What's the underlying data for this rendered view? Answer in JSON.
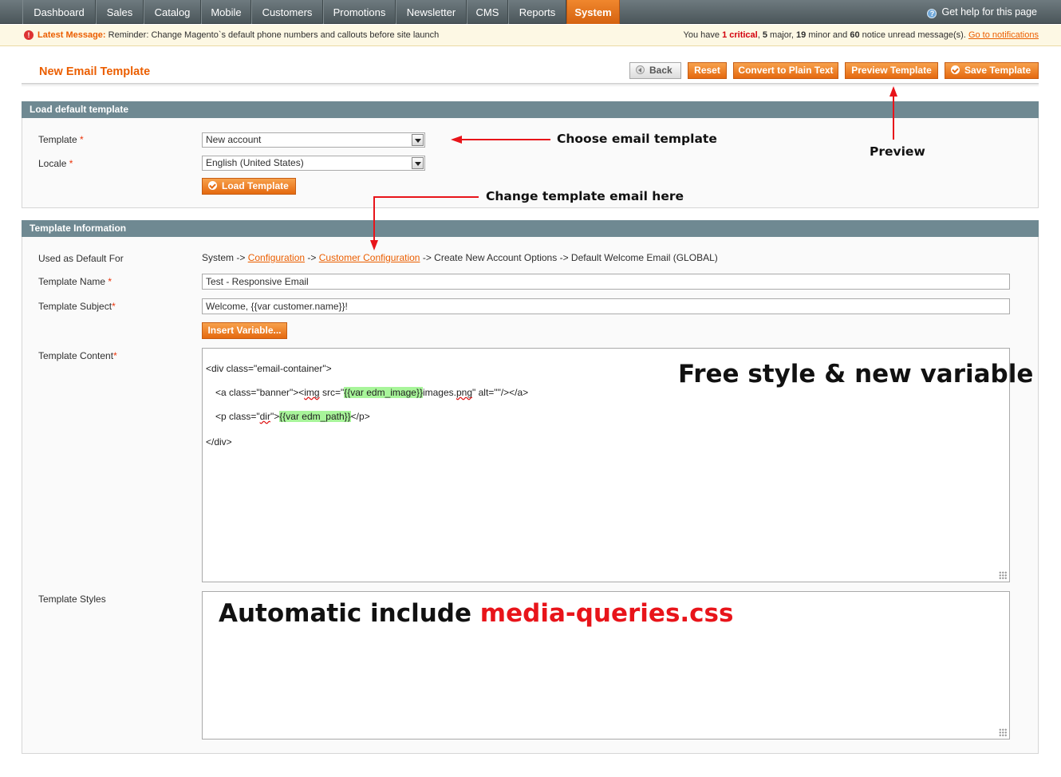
{
  "nav": {
    "items": [
      "Dashboard",
      "Sales",
      "Catalog",
      "Mobile",
      "Customers",
      "Promotions",
      "Newsletter",
      "CMS",
      "Reports",
      "System"
    ],
    "active": "System",
    "help": "Get help for this page"
  },
  "message": {
    "latest_label": "Latest Message:",
    "latest_text": " Reminder: Change Magento`s default phone numbers and callouts before site launch",
    "c1": "You have ",
    "critical_n": "1 critical",
    "c2": ", ",
    "major_n": "5",
    "c3": " major, ",
    "minor_n": "19",
    "c4": " minor and ",
    "notice_n": "60",
    "c5": " notice unread message(s). ",
    "link": "Go to notifications"
  },
  "page": {
    "title": "New Email Template",
    "buttons": {
      "back": "Back",
      "reset": "Reset",
      "plain": "Convert to Plain Text",
      "preview": "Preview Template",
      "save": "Save Template"
    }
  },
  "load": {
    "header": "Load default template",
    "template_label": "Template",
    "template_value": "New account",
    "locale_label": "Locale",
    "locale_value": "English (United States)",
    "load_button": "Load Template",
    "req": "*"
  },
  "info": {
    "header": "Template Information",
    "used_label": "Used as Default For",
    "crumb_1": "System -> ",
    "crumb_link1": "Configuration",
    "crumb_2": " -> ",
    "crumb_link2": "Customer Configuration",
    "crumb_3": " -> Create New Account Options -> Default Welcome Email  (GLOBAL)",
    "name_label": "Template Name",
    "name_value": "Test - Responsive Email",
    "subject_label": "Template Subject",
    "subject_value": "Welcome, {{var customer.name}}!",
    "insert_button": "Insert Variable...",
    "content_label": "Template Content",
    "styles_label": "Template Styles",
    "code": {
      "l1": "<div class=\"email-container\">",
      "l2a": "<a class=\"banner\"><",
      "l2b": "img",
      "l2c": " src=\"",
      "l2d": "{{var edm_image}}",
      "l2e": "images.",
      "l2f": "png",
      "l2g": "\" alt=\"\"/></a>",
      "l3a": "<p class=\"",
      "l3b": "dir",
      "l3c": "\">",
      "l3d": "{{var edm_path}}",
      "l3e": "</p>",
      "l4": "</div>"
    }
  },
  "annotations": {
    "choose": "Choose email template",
    "preview": "Preview",
    "change": "Change template email here",
    "free": "Free style & new variable",
    "auto_a": "Automatic include ",
    "auto_b": "media-queries.css",
    "arrow_color": "#e8141a"
  }
}
